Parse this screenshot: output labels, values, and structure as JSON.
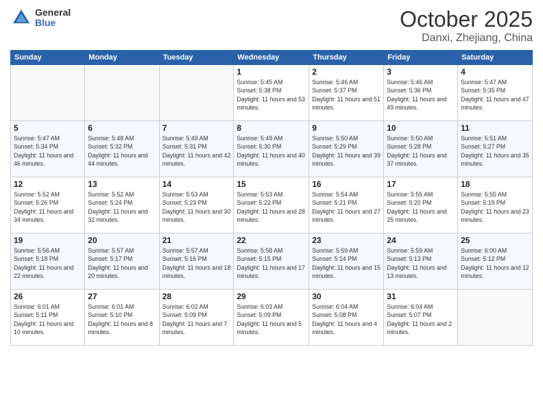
{
  "header": {
    "logo_general": "General",
    "logo_blue": "Blue",
    "month": "October 2025",
    "location": "Danxi, Zhejiang, China"
  },
  "days_of_week": [
    "Sunday",
    "Monday",
    "Tuesday",
    "Wednesday",
    "Thursday",
    "Friday",
    "Saturday"
  ],
  "weeks": [
    [
      {
        "day": "",
        "sunrise": "",
        "sunset": "",
        "daylight": ""
      },
      {
        "day": "",
        "sunrise": "",
        "sunset": "",
        "daylight": ""
      },
      {
        "day": "",
        "sunrise": "",
        "sunset": "",
        "daylight": ""
      },
      {
        "day": "1",
        "sunrise": "Sunrise: 5:45 AM",
        "sunset": "Sunset: 5:38 PM",
        "daylight": "Daylight: 11 hours and 53 minutes."
      },
      {
        "day": "2",
        "sunrise": "Sunrise: 5:46 AM",
        "sunset": "Sunset: 5:37 PM",
        "daylight": "Daylight: 11 hours and 51 minutes."
      },
      {
        "day": "3",
        "sunrise": "Sunrise: 5:46 AM",
        "sunset": "Sunset: 5:36 PM",
        "daylight": "Daylight: 11 hours and 49 minutes."
      },
      {
        "day": "4",
        "sunrise": "Sunrise: 5:47 AM",
        "sunset": "Sunset: 5:35 PM",
        "daylight": "Daylight: 11 hours and 47 minutes."
      }
    ],
    [
      {
        "day": "5",
        "sunrise": "Sunrise: 5:47 AM",
        "sunset": "Sunset: 5:34 PM",
        "daylight": "Daylight: 11 hours and 46 minutes."
      },
      {
        "day": "6",
        "sunrise": "Sunrise: 5:48 AM",
        "sunset": "Sunset: 5:32 PM",
        "daylight": "Daylight: 11 hours and 44 minutes."
      },
      {
        "day": "7",
        "sunrise": "Sunrise: 5:49 AM",
        "sunset": "Sunset: 5:31 PM",
        "daylight": "Daylight: 11 hours and 42 minutes."
      },
      {
        "day": "8",
        "sunrise": "Sunrise: 5:49 AM",
        "sunset": "Sunset: 5:30 PM",
        "daylight": "Daylight: 11 hours and 40 minutes."
      },
      {
        "day": "9",
        "sunrise": "Sunrise: 5:50 AM",
        "sunset": "Sunset: 5:29 PM",
        "daylight": "Daylight: 11 hours and 39 minutes."
      },
      {
        "day": "10",
        "sunrise": "Sunrise: 5:50 AM",
        "sunset": "Sunset: 5:28 PM",
        "daylight": "Daylight: 11 hours and 37 minutes."
      },
      {
        "day": "11",
        "sunrise": "Sunrise: 5:51 AM",
        "sunset": "Sunset: 5:27 PM",
        "daylight": "Daylight: 11 hours and 35 minutes."
      }
    ],
    [
      {
        "day": "12",
        "sunrise": "Sunrise: 5:52 AM",
        "sunset": "Sunset: 5:26 PM",
        "daylight": "Daylight: 11 hours and 34 minutes."
      },
      {
        "day": "13",
        "sunrise": "Sunrise: 5:52 AM",
        "sunset": "Sunset: 5:24 PM",
        "daylight": "Daylight: 11 hours and 32 minutes."
      },
      {
        "day": "14",
        "sunrise": "Sunrise: 5:53 AM",
        "sunset": "Sunset: 5:23 PM",
        "daylight": "Daylight: 11 hours and 30 minutes."
      },
      {
        "day": "15",
        "sunrise": "Sunrise: 5:53 AM",
        "sunset": "Sunset: 5:22 PM",
        "daylight": "Daylight: 11 hours and 28 minutes."
      },
      {
        "day": "16",
        "sunrise": "Sunrise: 5:54 AM",
        "sunset": "Sunset: 5:21 PM",
        "daylight": "Daylight: 11 hours and 27 minutes."
      },
      {
        "day": "17",
        "sunrise": "Sunrise: 5:55 AM",
        "sunset": "Sunset: 5:20 PM",
        "daylight": "Daylight: 11 hours and 25 minutes."
      },
      {
        "day": "18",
        "sunrise": "Sunrise: 5:55 AM",
        "sunset": "Sunset: 5:19 PM",
        "daylight": "Daylight: 11 hours and 23 minutes."
      }
    ],
    [
      {
        "day": "19",
        "sunrise": "Sunrise: 5:56 AM",
        "sunset": "Sunset: 5:18 PM",
        "daylight": "Daylight: 11 hours and 22 minutes."
      },
      {
        "day": "20",
        "sunrise": "Sunrise: 5:57 AM",
        "sunset": "Sunset: 5:17 PM",
        "daylight": "Daylight: 11 hours and 20 minutes."
      },
      {
        "day": "21",
        "sunrise": "Sunrise: 5:57 AM",
        "sunset": "Sunset: 5:16 PM",
        "daylight": "Daylight: 11 hours and 18 minutes."
      },
      {
        "day": "22",
        "sunrise": "Sunrise: 5:58 AM",
        "sunset": "Sunset: 5:15 PM",
        "daylight": "Daylight: 11 hours and 17 minutes."
      },
      {
        "day": "23",
        "sunrise": "Sunrise: 5:59 AM",
        "sunset": "Sunset: 5:14 PM",
        "daylight": "Daylight: 11 hours and 15 minutes."
      },
      {
        "day": "24",
        "sunrise": "Sunrise: 5:59 AM",
        "sunset": "Sunset: 5:13 PM",
        "daylight": "Daylight: 11 hours and 13 minutes."
      },
      {
        "day": "25",
        "sunrise": "Sunrise: 6:00 AM",
        "sunset": "Sunset: 5:12 PM",
        "daylight": "Daylight: 11 hours and 12 minutes."
      }
    ],
    [
      {
        "day": "26",
        "sunrise": "Sunrise: 6:01 AM",
        "sunset": "Sunset: 5:11 PM",
        "daylight": "Daylight: 11 hours and 10 minutes."
      },
      {
        "day": "27",
        "sunrise": "Sunrise: 6:01 AM",
        "sunset": "Sunset: 5:10 PM",
        "daylight": "Daylight: 11 hours and 8 minutes."
      },
      {
        "day": "28",
        "sunrise": "Sunrise: 6:02 AM",
        "sunset": "Sunset: 5:09 PM",
        "daylight": "Daylight: 11 hours and 7 minutes."
      },
      {
        "day": "29",
        "sunrise": "Sunrise: 6:03 AM",
        "sunset": "Sunset: 5:09 PM",
        "daylight": "Daylight: 11 hours and 5 minutes."
      },
      {
        "day": "30",
        "sunrise": "Sunrise: 6:04 AM",
        "sunset": "Sunset: 5:08 PM",
        "daylight": "Daylight: 11 hours and 4 minutes."
      },
      {
        "day": "31",
        "sunrise": "Sunrise: 6:04 AM",
        "sunset": "Sunset: 5:07 PM",
        "daylight": "Daylight: 11 hours and 2 minutes."
      },
      {
        "day": "",
        "sunrise": "",
        "sunset": "",
        "daylight": ""
      }
    ]
  ]
}
